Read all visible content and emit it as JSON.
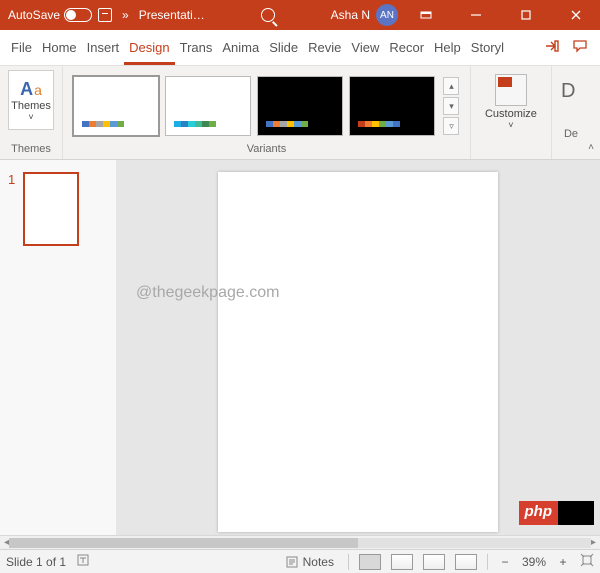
{
  "titlebar": {
    "autosave_label": "AutoSave",
    "autosave_state": "Off",
    "doc_title": "Presentati…",
    "user_name": "Asha N",
    "user_initials": "AN"
  },
  "tabs": {
    "file": "File",
    "home": "Home",
    "insert": "Insert",
    "design": "Design",
    "transitions": "Trans",
    "animations": "Anima",
    "slideshow": "Slide",
    "review": "Revie",
    "view": "View",
    "recording": "Recor",
    "help": "Help",
    "storyline": "Storyl"
  },
  "ribbon": {
    "themes_label": "Themes",
    "themes_btn": "Themes",
    "variants_label": "Variants",
    "customize_label": "Customize",
    "designer_label": "De"
  },
  "thumb": {
    "slide_number": "1"
  },
  "watermark": "@thegeekpage.com",
  "badge": {
    "text": "php"
  },
  "status": {
    "slide_counter": "Slide 1 of 1",
    "notes_label": "Notes",
    "zoom_value": "39%"
  }
}
